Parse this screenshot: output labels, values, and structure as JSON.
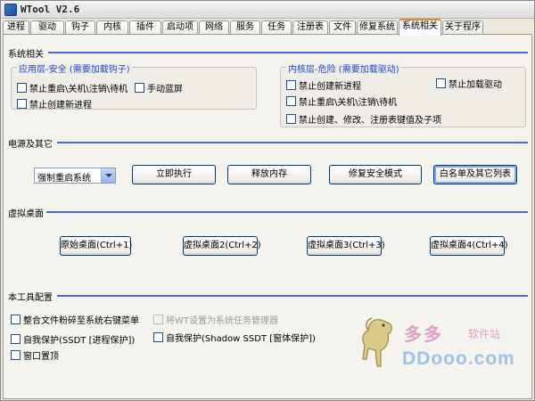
{
  "window": {
    "title": "WTool V2.6"
  },
  "tabs": [
    "进程",
    "驱动",
    "钩子",
    "内核",
    "插件",
    "启动项",
    "网络",
    "服务",
    "任务",
    "注册表",
    "文件",
    "修复系统",
    "系统相关",
    "关于程序"
  ],
  "active_tab": "系统相关",
  "system_section": {
    "title": "系统相关",
    "app_group": {
      "title": "应用层-安全 (需要加载钩子)",
      "items": [
        {
          "label": "禁止重启\\关机\\注销\\待机",
          "checked": false
        },
        {
          "label": "手动蓝屏",
          "checked": false
        },
        {
          "label": "禁止创建新进程",
          "checked": false
        }
      ]
    },
    "kernel_group": {
      "title": "内核层-危险 (需要加载驱动)",
      "items": [
        {
          "label": "禁止创建新进程",
          "checked": false
        },
        {
          "label": "禁止加载驱动",
          "checked": false
        },
        {
          "label": "禁止重启\\关机\\注销\\待机",
          "checked": false
        },
        {
          "label": "禁止创建、修改、注册表键值及子项",
          "checked": false
        }
      ]
    }
  },
  "power_section": {
    "title": "电源及其它",
    "select_value": "强制重启系统",
    "buttons": [
      "立即执行",
      "释放内存",
      "修复安全模式",
      "白名单及其它列表"
    ]
  },
  "virtual_section": {
    "title": "虚拟桌面",
    "buttons": [
      "原始桌面(Ctrl+1)",
      "虚拟桌面2(Ctrl+2)",
      "虚拟桌面3(Ctrl+3)",
      "虚拟桌面4(Ctrl+4)"
    ]
  },
  "config_section": {
    "title": "本工具配置",
    "items": [
      {
        "label": "整合文件粉碎至系统右键菜单",
        "checked": false,
        "enabled": true
      },
      {
        "label": "将WT设置为系统任务管理器",
        "checked": false,
        "enabled": false
      },
      {
        "label": "自我保护(SSDT [进程保护])",
        "checked": false,
        "enabled": true
      },
      {
        "label": "自我保护(Shadow SSDT [窗体保护])",
        "checked": false,
        "enabled": true
      },
      {
        "label": "窗口置顶",
        "checked": false,
        "enabled": true
      }
    ]
  },
  "watermark": {
    "cn": "多多",
    "cn_small": "软件站",
    "en": "DDooo.com"
  },
  "colors": {
    "section_line": "#4a66d8",
    "group_title": "#1e48d8",
    "active_tab_top": "#e68b2c"
  }
}
